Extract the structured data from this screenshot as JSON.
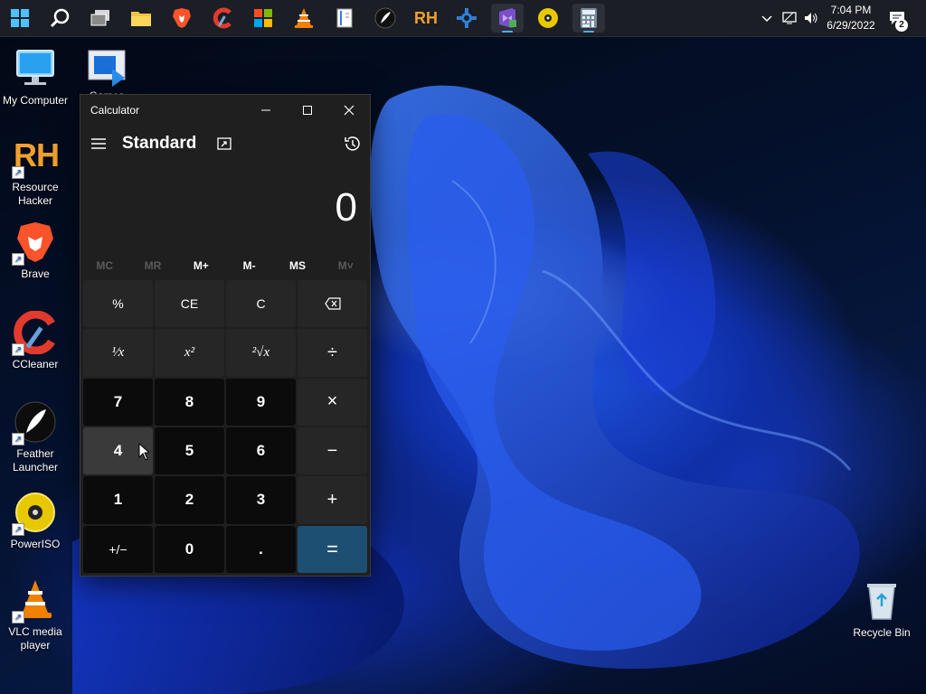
{
  "taskbar": {
    "icons": [
      "start-icon",
      "search-icon",
      "task-view-icon",
      "file-explorer-icon",
      "brave-icon",
      "ccleaner-icon",
      "app-icon",
      "vlc-icon",
      "notes-icon",
      "feather-icon",
      "resource-hacker-icon",
      "dev-icon",
      "visual-studio-icon",
      "poweriso-icon",
      "calculator-icon"
    ],
    "rh_text": "RH",
    "time": "7:04 PM",
    "date": "6/29/2022",
    "notification_count": "2"
  },
  "desktop": {
    "icons": [
      {
        "label": "My Computer"
      },
      {
        "label": "Games"
      },
      {
        "label": "Resource Hacker",
        "glyph": "RH"
      },
      {
        "label": "Brave"
      },
      {
        "label": "CCleaner"
      },
      {
        "label": "Feather Launcher"
      },
      {
        "label": "PowerISO"
      },
      {
        "label": "VLC media player"
      },
      {
        "label": "Recycle Bin"
      }
    ]
  },
  "calculator": {
    "window_title": "Calculator",
    "mode": "Standard",
    "display": "0",
    "memory": [
      "MC",
      "MR",
      "M+",
      "M-",
      "MS",
      "M˅"
    ],
    "keys": [
      {
        "label": "%",
        "kind": "op"
      },
      {
        "label": "CE",
        "kind": "op"
      },
      {
        "label": "C",
        "kind": "op"
      },
      {
        "label": "⌫",
        "kind": "op"
      },
      {
        "label": "¹⁄x",
        "kind": "op"
      },
      {
        "label": "x²",
        "kind": "op"
      },
      {
        "label": "²√x",
        "kind": "op"
      },
      {
        "label": "÷",
        "kind": "op"
      },
      {
        "label": "7",
        "kind": "num"
      },
      {
        "label": "8",
        "kind": "num"
      },
      {
        "label": "9",
        "kind": "num"
      },
      {
        "label": "×",
        "kind": "op"
      },
      {
        "label": "4",
        "kind": "num"
      },
      {
        "label": "5",
        "kind": "num"
      },
      {
        "label": "6",
        "kind": "num"
      },
      {
        "label": "−",
        "kind": "op"
      },
      {
        "label": "1",
        "kind": "num"
      },
      {
        "label": "2",
        "kind": "num"
      },
      {
        "label": "3",
        "kind": "num"
      },
      {
        "label": "+",
        "kind": "op"
      },
      {
        "label": "+/−",
        "kind": "num"
      },
      {
        "label": "0",
        "kind": "num"
      },
      {
        "label": ".",
        "kind": "num"
      },
      {
        "label": "=",
        "kind": "eq"
      }
    ],
    "accent_color": "#1d4f73"
  }
}
